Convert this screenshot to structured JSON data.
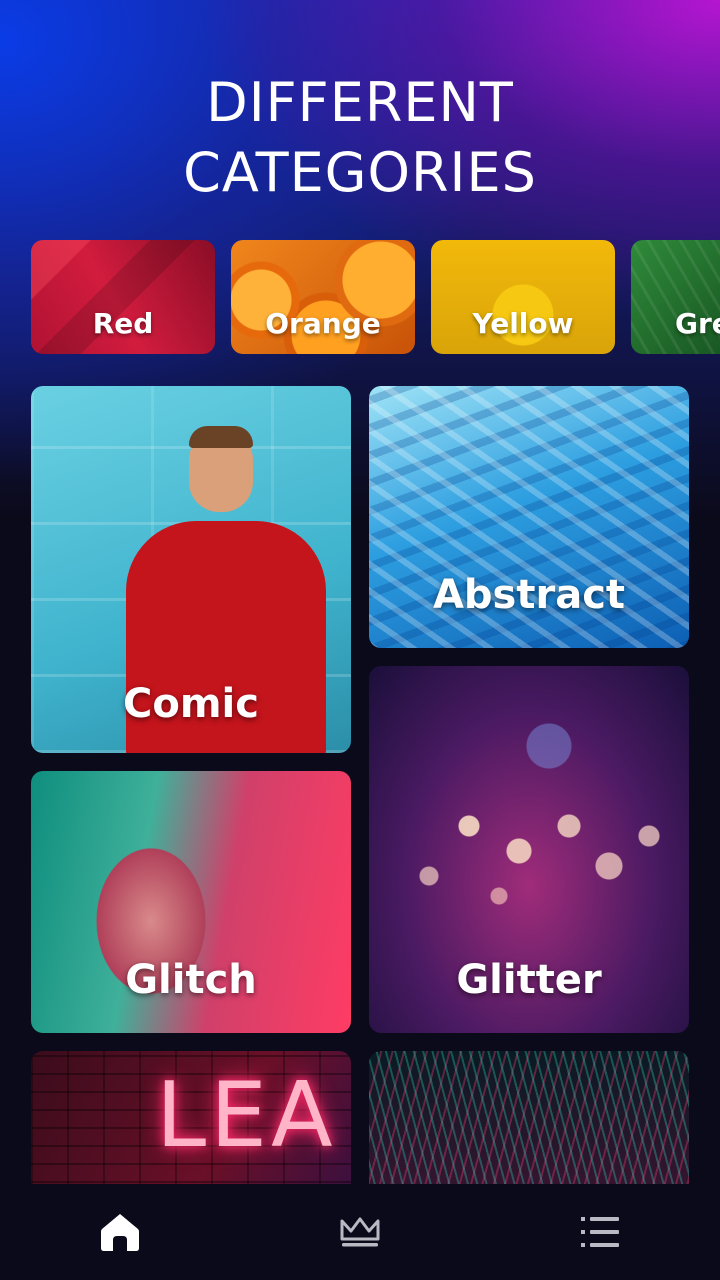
{
  "header": {
    "title_line1": "DIFFERENT",
    "title_line2": "CATEGORIES"
  },
  "color_chips": [
    {
      "label": "Red",
      "color": "#c2173a"
    },
    {
      "label": "Orange",
      "color": "#f0861c"
    },
    {
      "label": "Yellow",
      "color": "#f2b90a"
    },
    {
      "label": "Gre",
      "color": "#2f8a3a"
    }
  ],
  "categories": [
    {
      "label": "Comic"
    },
    {
      "label": "Abstract"
    },
    {
      "label": "Glitch"
    },
    {
      "label": "Glitter"
    },
    {
      "label": "",
      "neon_text": "LEA"
    },
    {
      "label": ""
    }
  ],
  "bottom_nav": {
    "items": [
      {
        "icon": "home-icon",
        "active": true
      },
      {
        "icon": "crown-icon",
        "active": false
      },
      {
        "icon": "list-icon",
        "active": false
      }
    ],
    "active_color": "#ffffff",
    "inactive_color": "#b9b9c4"
  }
}
